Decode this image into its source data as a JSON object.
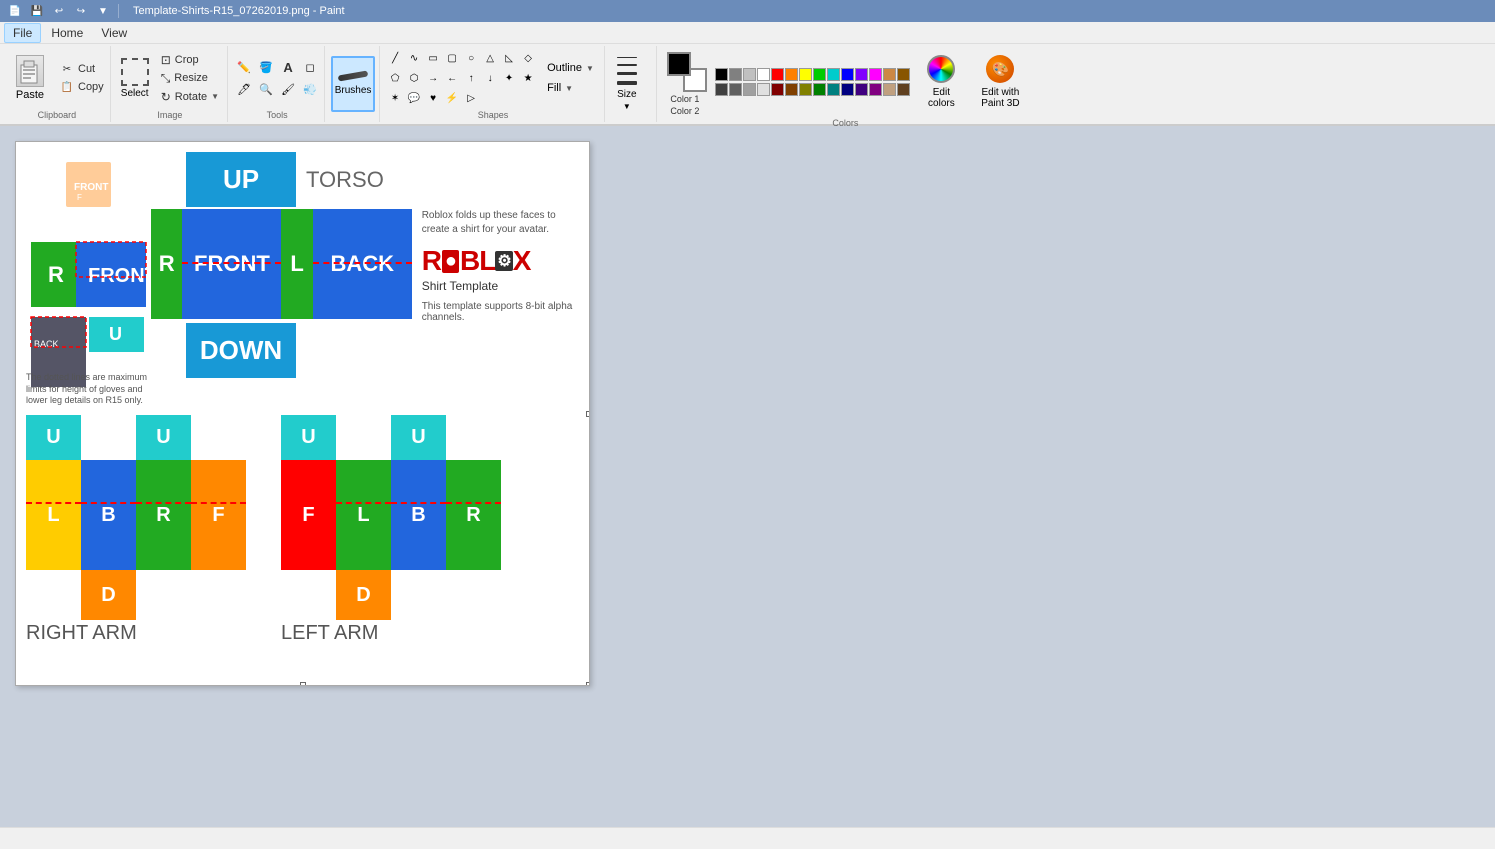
{
  "titlebar": {
    "title": "Template-Shirts-R15_07262019.png - Paint",
    "save_icon": "💾",
    "new_icon": "📄"
  },
  "quickaccess": {
    "new_label": "📄",
    "save_label": "💾",
    "undo_label": "↩",
    "redo_label": "↪",
    "dropdown_label": "▼"
  },
  "menu": {
    "file": "File",
    "home": "Home",
    "view": "View"
  },
  "ribbon": {
    "clipboard": {
      "label": "Clipboard",
      "paste": "Paste",
      "cut": "Cut",
      "copy": "Copy"
    },
    "image": {
      "label": "Image",
      "crop": "Crop",
      "resize": "Resize",
      "rotate": "Rotate"
    },
    "tools": {
      "label": "Tools"
    },
    "brushes": {
      "label": "Brushes"
    },
    "shapes": {
      "label": "Shapes",
      "outline": "Outline",
      "fill": "Fill"
    },
    "size": {
      "label": "Size"
    },
    "colors": {
      "label": "Colors",
      "color1": "Color 1",
      "color2": "Color 2",
      "edit_colors": "Edit colors",
      "edit_with_paint3d": "Edit with Paint 3D"
    }
  },
  "template": {
    "torso_label": "TORSO",
    "up": "UP",
    "front": "FRONT",
    "back": "BACK",
    "down": "DOWN",
    "r": "R",
    "l": "L",
    "right_arm": "RIGHT ARM",
    "left_arm": "LEFT ARM",
    "roblox_logo": "ROBLOX",
    "shirt_template": "Shirt Template",
    "info1": "Roblox folds up these faces to create a shirt for your avatar.",
    "info2": "This template supports 8-bit alpha channels.",
    "dotted_note": "The dotted lines are maximum limits for height of gloves and lower leg details on R15 only.",
    "arm_up_r": "U",
    "arm_up_l": "U",
    "arm_down_r": "D",
    "arm_down_l": "D",
    "arm_r_l": "L",
    "arm_r_b": "B",
    "arm_r_r": "R",
    "arm_r_f": "F",
    "arm_l_f": "F",
    "arm_l_l": "L",
    "arm_l_b": "B",
    "arm_l_r": "R"
  },
  "colors": {
    "row1": [
      "#000000",
      "#808080",
      "#c0c0c0",
      "#ffffff",
      "#ff0000",
      "#ff8000",
      "#ffff00",
      "#00ff00",
      "#00ffff",
      "#0000ff",
      "#8000ff",
      "#ff00ff",
      "#ff8080",
      "#ff8040"
    ],
    "row2": [
      "#404040",
      "#606060",
      "#a0a0a0",
      "#e0e0e0",
      "#800000",
      "#804000",
      "#808000",
      "#008000",
      "#008080",
      "#000080",
      "#400080",
      "#800080",
      "#ffc0c0",
      "#ffa060"
    ],
    "row3": [
      "#ffffff",
      "#d0d0d0",
      "#b0b0b0",
      "#909090",
      "#ff6060",
      "#ffa050",
      "#ffff80",
      "#80ff80",
      "#80ffff",
      "#8080ff",
      "#c080ff",
      "#ff80ff"
    ],
    "row4": [
      "#f0f0f0",
      "#c0c0c0",
      "#909090",
      "#606060",
      "#e08080",
      "#e0a070",
      "#e0e090",
      "#90e090",
      "#90e0e0",
      "#9090e0",
      "#c090e0",
      "#e090e0"
    ]
  },
  "status": {
    "position": "",
    "size": ""
  }
}
